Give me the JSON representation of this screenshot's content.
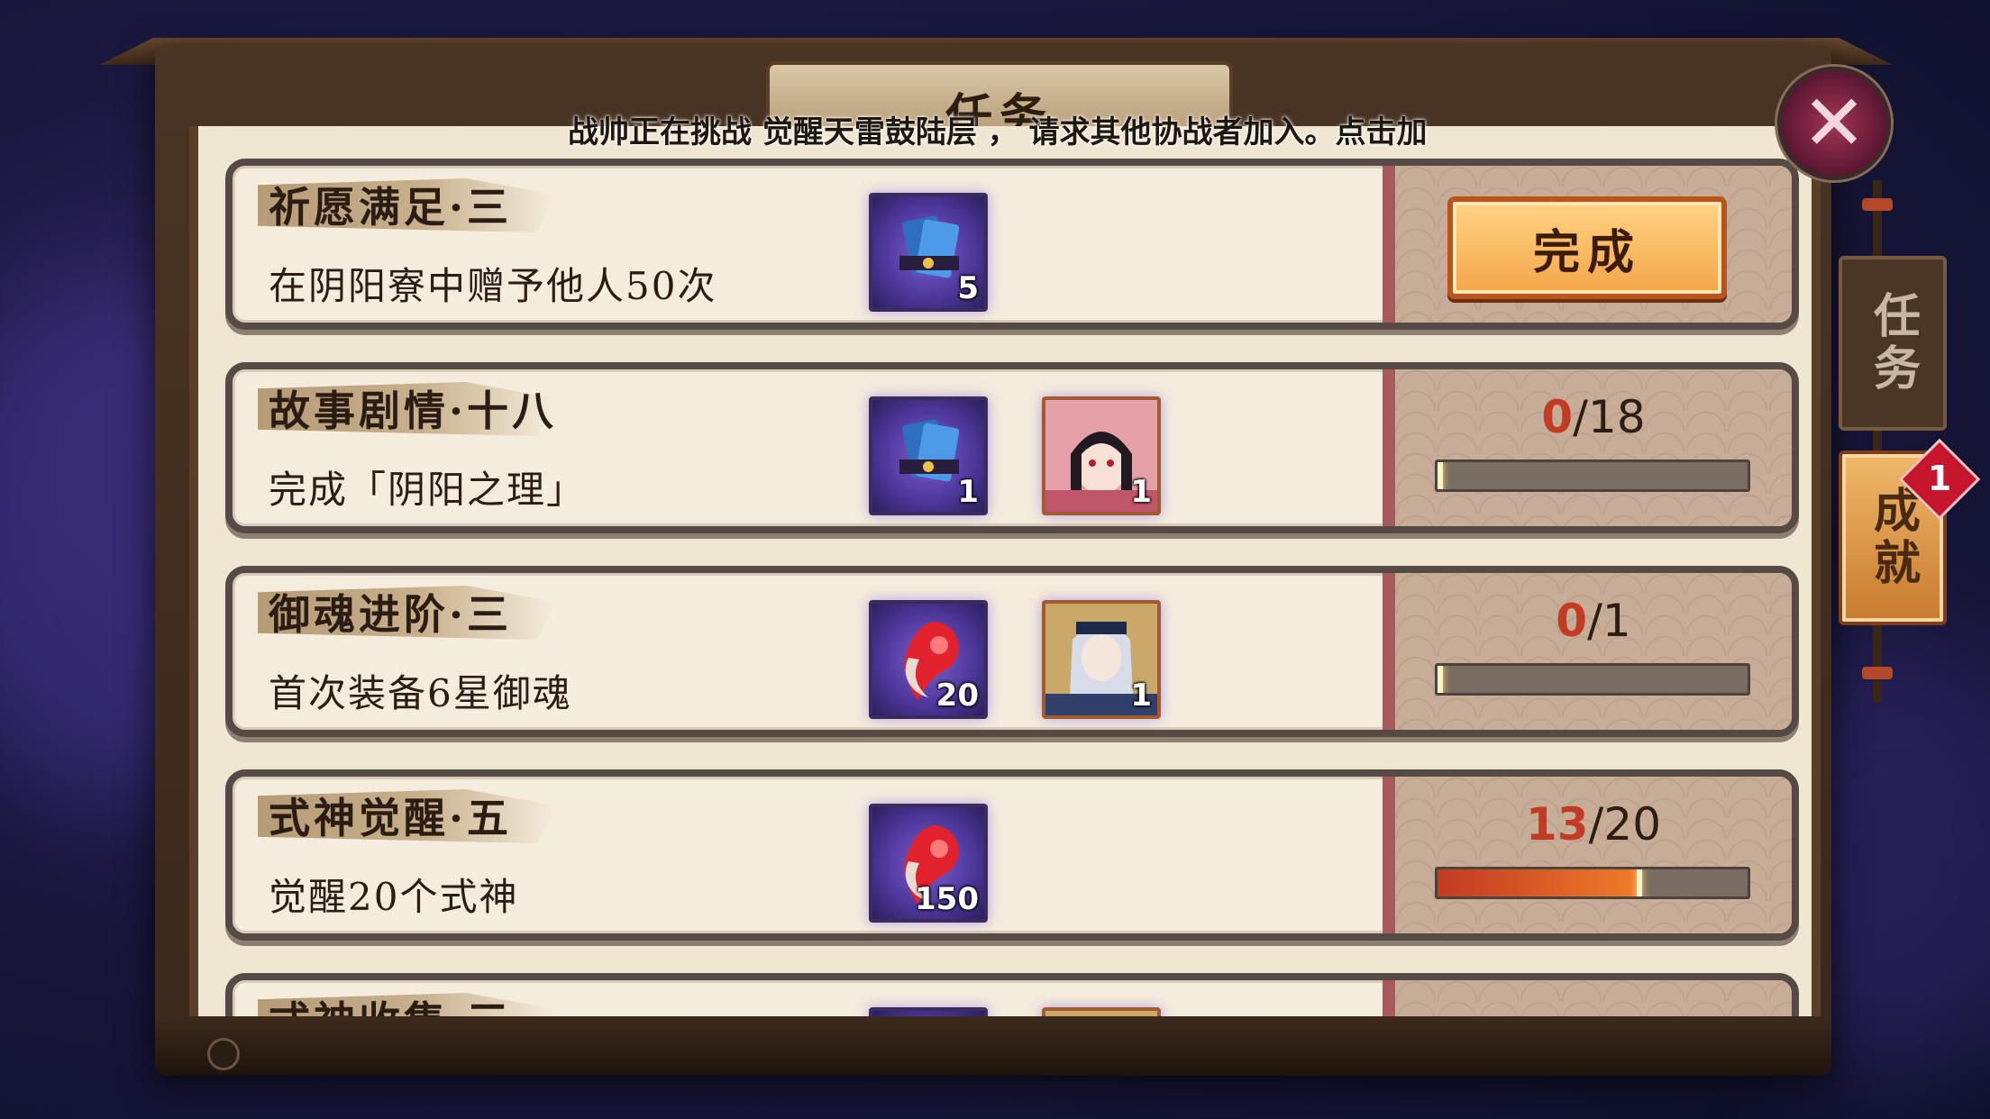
{
  "dialog": {
    "title": "任务",
    "broadcast": "战帅正在挑战 觉醒天雷鼓陆层 ， 请求其他协战者加入。点击加",
    "close_icon": "✕"
  },
  "tabs": [
    {
      "label": "任务",
      "active": false
    },
    {
      "label": "成就",
      "active": true,
      "badge": "1"
    }
  ],
  "colors": {
    "accent_red": "#c23b22",
    "button": "#f4a548",
    "reward_bg": "#4c3698"
  },
  "tasks": [
    {
      "name": "祈愿满足·三",
      "desc": "在阴阳寮中赠予他人50次",
      "rewards": [
        {
          "icon": "blue-talisman-icon",
          "count": "5"
        }
      ],
      "status": "complete",
      "button_label": "完成"
    },
    {
      "name": "故事剧情·十八",
      "desc": "完成「阴阳之理」",
      "rewards": [
        {
          "icon": "blue-talisman-icon",
          "count": "1"
        },
        {
          "icon": "shikigami-portrait-girl",
          "count": "1"
        }
      ],
      "status": "progress",
      "progress": {
        "current": "0",
        "sep": "/",
        "total": "18",
        "fraction": 0.0
      }
    },
    {
      "name": "御魂进阶·三",
      "desc": "首次装备6星御魂",
      "rewards": [
        {
          "icon": "red-soul-orb-icon",
          "count": "20"
        },
        {
          "icon": "shikigami-portrait-silver",
          "count": "1"
        }
      ],
      "status": "progress",
      "progress": {
        "current": "0",
        "sep": "/",
        "total": "1",
        "fraction": 0.0
      }
    },
    {
      "name": "式神觉醒·五",
      "desc": "觉醒20个式神",
      "rewards": [
        {
          "icon": "red-soul-orb-icon",
          "count": "150"
        }
      ],
      "status": "progress",
      "progress": {
        "current": "13",
        "sep": "/",
        "total": "20",
        "fraction": 0.65
      }
    },
    {
      "name": "式神收集·三",
      "desc": "",
      "rewards": [
        {
          "icon": "red-soul-orb-icon",
          "count": ""
        },
        {
          "icon": "shikigami-portrait",
          "count": ""
        }
      ],
      "status": "progress",
      "progress": {
        "current": "",
        "sep": "",
        "total": "",
        "fraction": 0.0
      }
    }
  ]
}
